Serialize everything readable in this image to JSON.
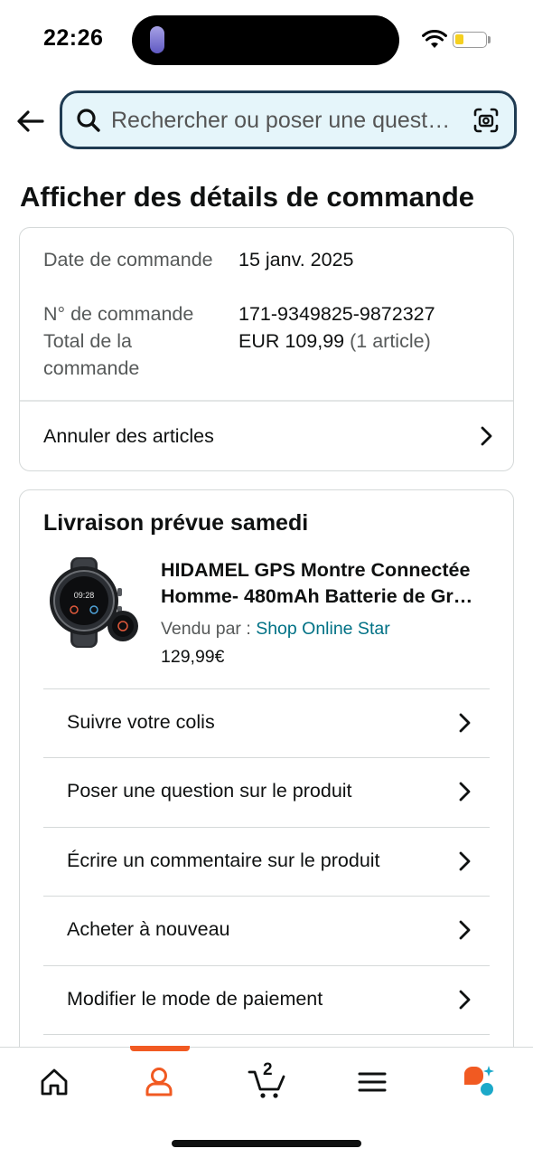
{
  "status_bar": {
    "time": "22:26"
  },
  "search": {
    "placeholder": "Rechercher ou poser une quest…"
  },
  "page_title": "Afficher des détails de commande",
  "order_summary": {
    "date_label": "Date de commande",
    "date_value": "15 janv. 2025",
    "number_label": "N° de commande",
    "number_value": "171-9349825-9872327",
    "total_label": "Total de la commande",
    "total_value": "EUR 109,99",
    "total_items": "(1 article)",
    "cancel_label": "Annuler des articles"
  },
  "delivery": {
    "title": "Livraison prévue samedi",
    "product": {
      "title_line1": "HIDAMEL GPS Montre Connectée",
      "title_line2": "Homme- 480mAh Batterie de Gr…",
      "sold_by_label": "Vendu par",
      "seller_separator": " : ",
      "seller_name": "Shop Online Star",
      "price": "129,99€"
    },
    "actions": [
      {
        "label": "Suivre votre colis"
      },
      {
        "label": "Poser une question sur le produit"
      },
      {
        "label": "Écrire un commentaire sur le produit"
      },
      {
        "label": "Acheter à nouveau"
      },
      {
        "label": "Modifier le mode de paiement"
      }
    ]
  },
  "bottom_nav": {
    "active": "account",
    "cart_count": "2",
    "accent_color": "#f15a22",
    "items": [
      {
        "name": "home",
        "icon": "home-icon"
      },
      {
        "name": "account",
        "icon": "user-icon"
      },
      {
        "name": "cart",
        "icon": "cart-icon"
      },
      {
        "name": "menu",
        "icon": "menu-icon"
      },
      {
        "name": "rufus",
        "icon": "chat-assistant-icon"
      }
    ]
  },
  "colors": {
    "link": "#007185",
    "search_bg": "#e5f5fa",
    "search_border": "#1f3b52",
    "text": "#0f1111",
    "muted": "#565959"
  }
}
